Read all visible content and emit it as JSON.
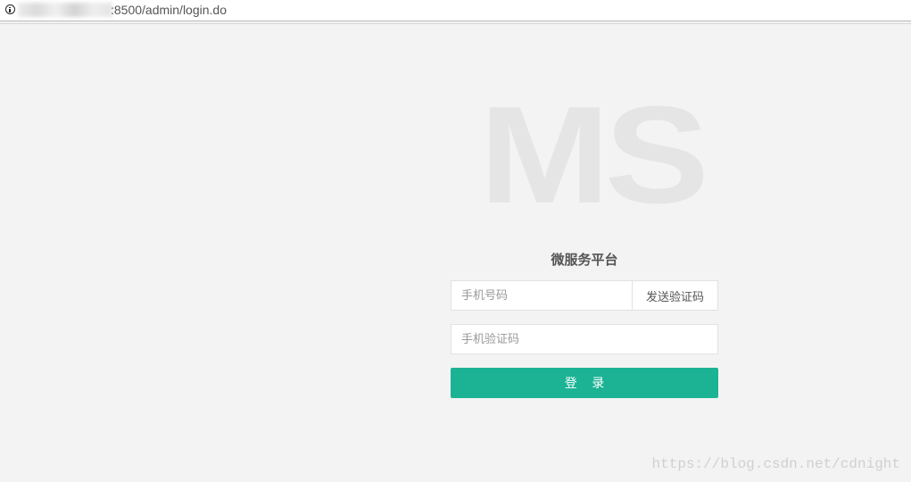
{
  "address_bar": {
    "url_text": ":8500/admin/login.do",
    "info_icon": "info-icon"
  },
  "logo": {
    "text": "MS"
  },
  "login_form": {
    "title": "微服务平台",
    "phone_placeholder": "手机号码",
    "send_code_label": "发送验证码",
    "code_placeholder": "手机验证码",
    "login_label": "登 录"
  },
  "colors": {
    "primary": "#1bb394",
    "background": "#f3f3f3",
    "logo": "#e5e5e5"
  },
  "watermark": {
    "text": "https://blog.csdn.net/cdnight"
  }
}
